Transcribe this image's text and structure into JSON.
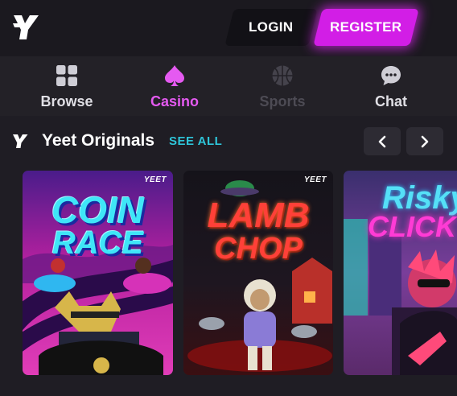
{
  "header": {
    "logo_icon": "yeet-logo-icon",
    "login_label": "LOGIN",
    "register_label": "REGISTER",
    "accent_color": "#d21ee6"
  },
  "nav": {
    "items": [
      {
        "label": "Browse",
        "icon": "grid-icon",
        "state": "normal"
      },
      {
        "label": "Casino",
        "icon": "spade-icon",
        "state": "active"
      },
      {
        "label": "Sports",
        "icon": "basketball-icon",
        "state": "disabled"
      },
      {
        "label": "Chat",
        "icon": "chat-bubble-icon",
        "state": "normal"
      }
    ],
    "active_color": "#e55af1"
  },
  "section": {
    "icon": "yeet-logo-icon",
    "title": "Yeet Originals",
    "see_all_label": "SEE ALL",
    "see_all_color": "#2ec5d9",
    "prev_icon": "chevron-left-icon",
    "next_icon": "chevron-right-icon"
  },
  "games": [
    {
      "title_line1": "COIN",
      "title_line2": "RACE",
      "tag": "YEET"
    },
    {
      "title_line1": "LAMB",
      "title_line2": "CHOP",
      "tag": "YEET"
    },
    {
      "title_line1": "Risky",
      "title_line2": "CLICK",
      "tag": ""
    }
  ]
}
